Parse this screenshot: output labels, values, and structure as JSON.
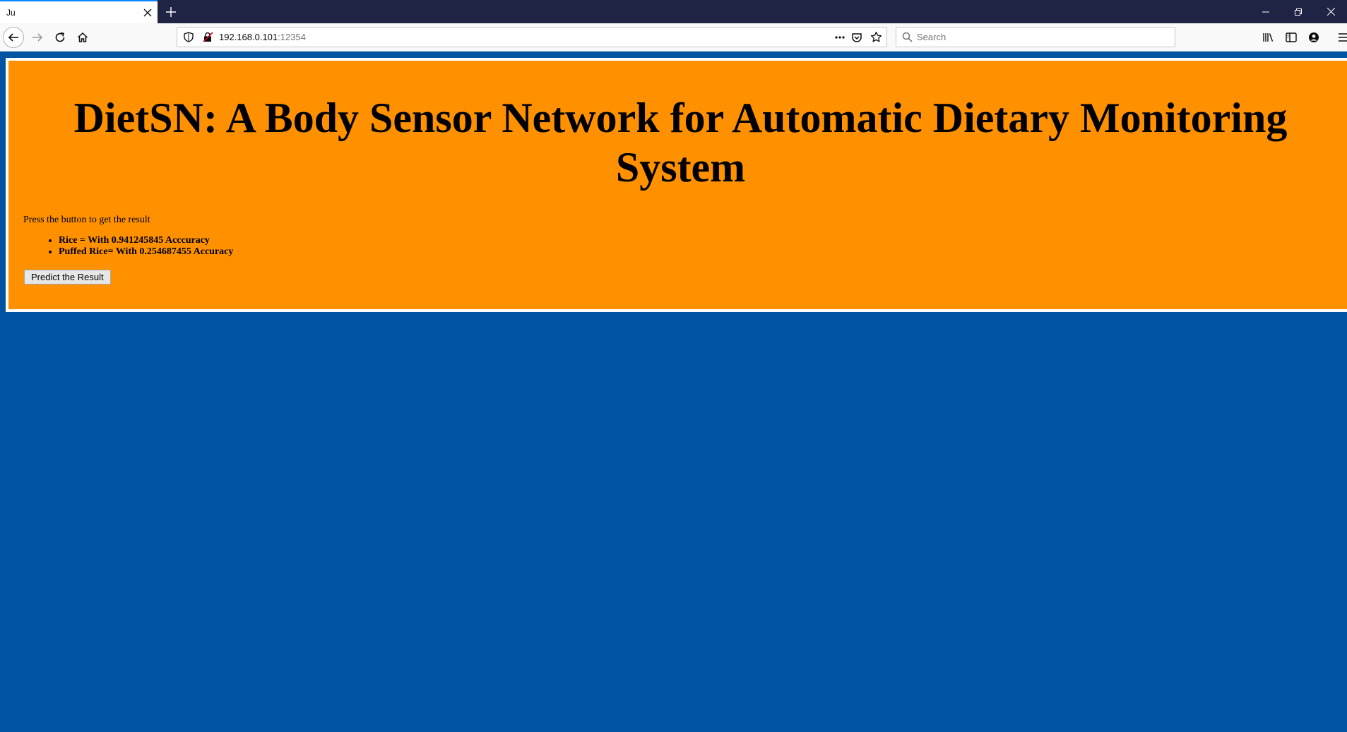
{
  "browser": {
    "tab_title": "Ju",
    "url_host": "192.168.0.101",
    "url_port": ":12354",
    "search_placeholder": "Search"
  },
  "page": {
    "title": "DietSN: A Body Sensor Network for Automatic Dietary Monitoring System",
    "instruction": "Press the button to get the result",
    "results": [
      "Rice = With 0.941245845 Acccuracy",
      "Puffed Rice= With 0.254687455 Accuracy"
    ],
    "button_label": "Predict the Result"
  },
  "colors": {
    "background": "#0054a2",
    "panel": "#ff9100",
    "panel_border": "#ffffff",
    "titlebar": "#1f2444"
  },
  "icons": [
    "close-icon",
    "plus-icon",
    "minimize-icon",
    "restore-icon",
    "back-arrow-icon",
    "forward-arrow-icon",
    "reload-icon",
    "home-icon",
    "shield-icon",
    "insecure-lock-icon",
    "more-icon",
    "pocket-icon",
    "star-icon",
    "search-icon",
    "library-icon",
    "sidebar-icon",
    "account-icon",
    "menu-icon"
  ]
}
